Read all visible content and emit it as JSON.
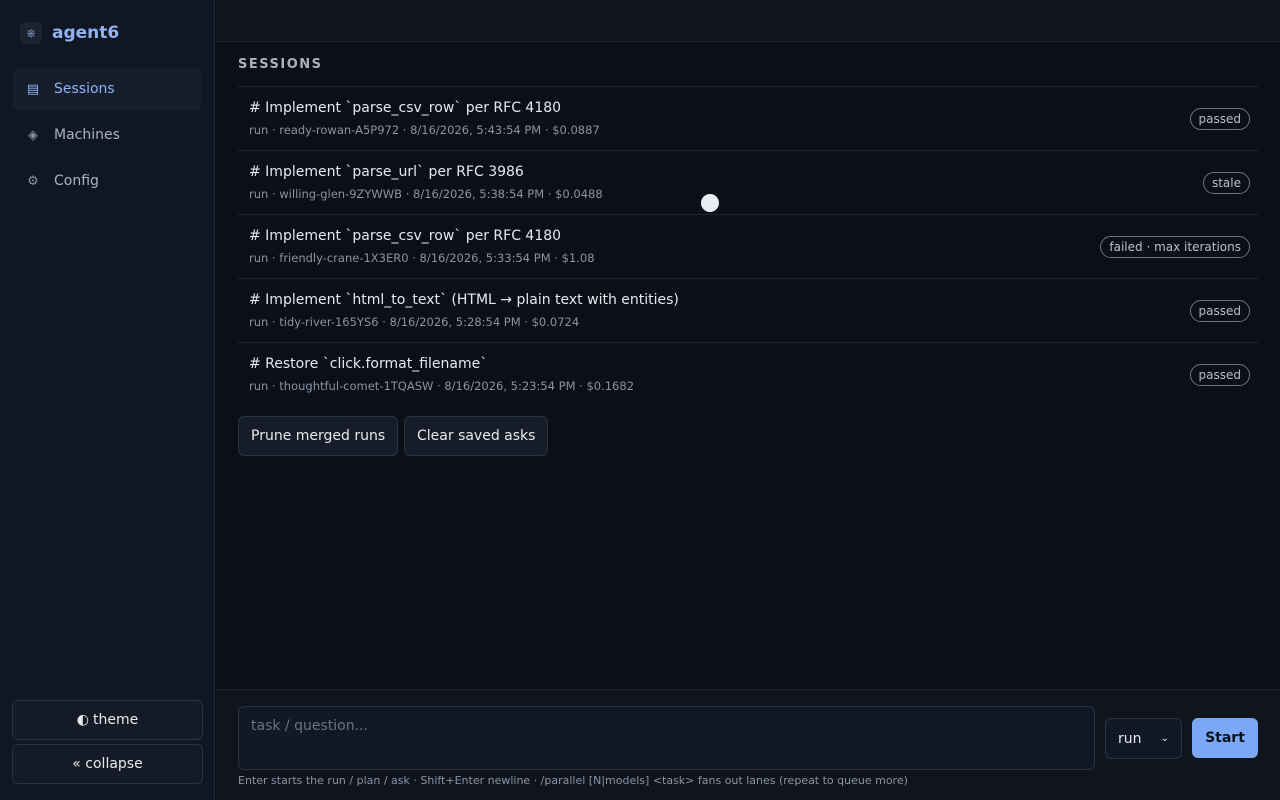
{
  "app": {
    "name": "agent6",
    "logo_icon": "agent-logo-icon"
  },
  "sidebar": {
    "items": [
      {
        "label": "Sessions",
        "icon": "list-icon",
        "active": true
      },
      {
        "label": "Machines",
        "icon": "diamond-icon",
        "active": false
      },
      {
        "label": "Config",
        "icon": "gear-icon",
        "active": false
      }
    ],
    "theme_label": "theme",
    "collapse_label": "« collapse"
  },
  "main": {
    "section_title": "SESSIONS",
    "sessions": [
      {
        "title": "# Implement `parse_csv_row` per RFC 4180",
        "meta": "run · ready-rowan-A5P972 · 8/16/2026, 5:43:54 PM · $0.0887",
        "status": "passed"
      },
      {
        "title": "# Implement `parse_url` per RFC 3986",
        "meta": "run · willing-glen-9ZYWWB · 8/16/2026, 5:38:54 PM · $0.0488",
        "status": "stale"
      },
      {
        "title": "# Implement `parse_csv_row` per RFC 4180",
        "meta": "run · friendly-crane-1X3ER0 · 8/16/2026, 5:33:54 PM · $1.08",
        "status": "failed · max iterations"
      },
      {
        "title": "# Implement `html_to_text` (HTML → plain text with entities)",
        "meta": "run · tidy-river-165YS6 · 8/16/2026, 5:28:54 PM · $0.0724",
        "status": "passed"
      },
      {
        "title": "# Restore `click.format_filename`",
        "meta": "run · thoughtful-comet-1TQASW · 8/16/2026, 5:23:54 PM · $0.1682",
        "status": "passed"
      }
    ],
    "prune_label": "Prune merged runs",
    "clear_label": "Clear saved asks"
  },
  "composer": {
    "placeholder": "task / question...",
    "mode": "run",
    "start_label": "Start",
    "hint": "Enter starts the run / plan / ask · Shift+Enter newline · /parallel [N|models] <task> fans out lanes (repeat to queue more)"
  },
  "colors": {
    "accent": "#7ba7f7",
    "background": "#0b0f17",
    "sidebar": "#111722"
  }
}
